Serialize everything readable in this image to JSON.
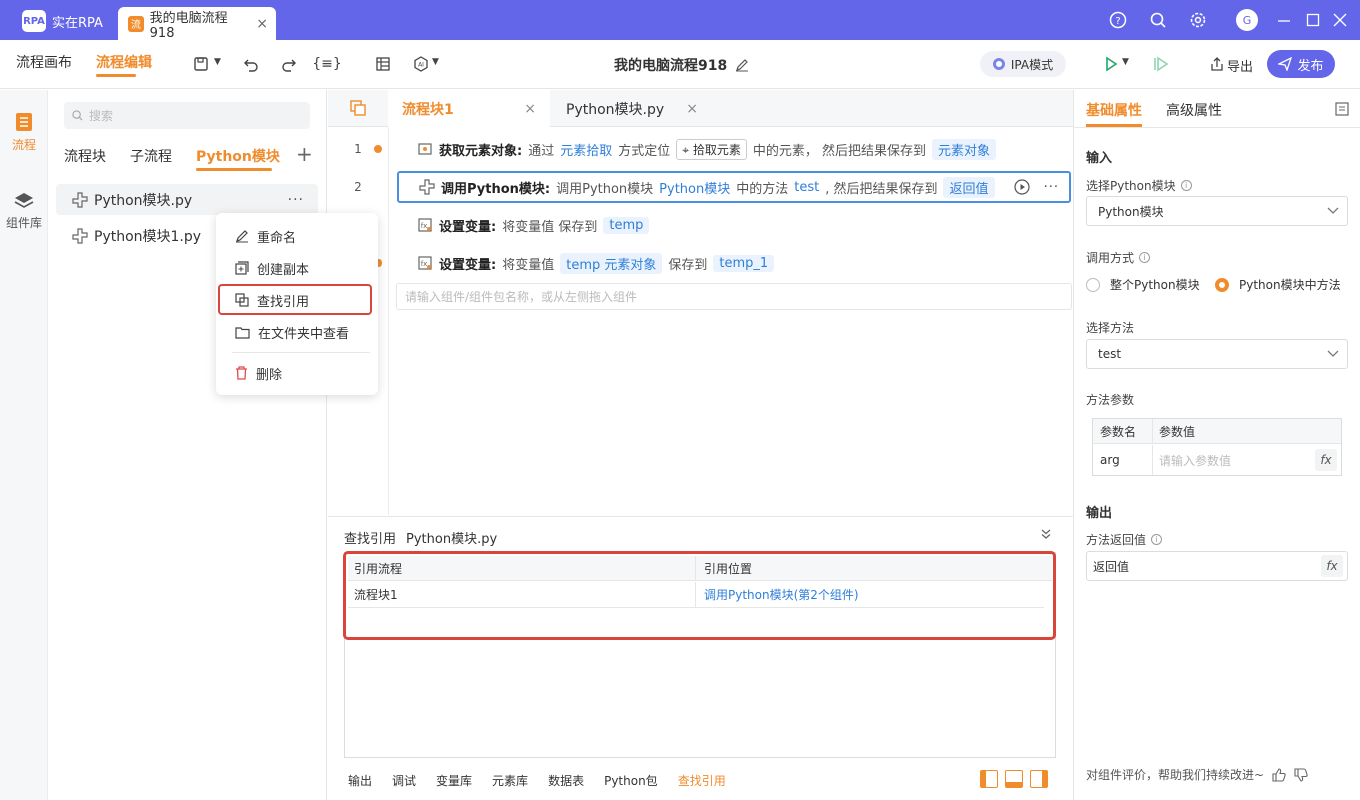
{
  "titlebar": {
    "app_name": "实在RPA",
    "logo_text": "RPA",
    "doc_tab": "我的电脑流程918",
    "tab_icon": "流",
    "avatar": "G",
    "accent": "#6366e8"
  },
  "toolbar": {
    "mode_canvas": "流程画布",
    "mode_edit": "流程编辑",
    "flow_title": "我的电脑流程918",
    "ipa_mode": "IPA模式",
    "export": "导出",
    "publish": "发布",
    "accent": "#f08c2c"
  },
  "rail": {
    "flow": "流程",
    "components": "组件库"
  },
  "left": {
    "search_placeholder": "搜索",
    "tabs": [
      "流程块",
      "子流程",
      "Python模块"
    ],
    "files": [
      "Python模块.py",
      "Python模块1.py"
    ],
    "more": "···"
  },
  "ctx_menu": {
    "items": [
      "重命名",
      "创建副本",
      "查找引用",
      "在文件夹中查看",
      "删除"
    ]
  },
  "editor": {
    "tabs": [
      "流程块1",
      "Python模块.py"
    ],
    "line_numbers": [
      "1",
      "2"
    ],
    "rows": [
      {
        "name": "获取元素对象:",
        "t1": "通过",
        "link": "元素拾取",
        "t2": "方式定位",
        "btn": "拾取元素",
        "t3": "中的元素， 然后把结果保存到",
        "tag": "元素对象"
      },
      {
        "name": "调用Python模块:",
        "t1": "调用Python模块",
        "link": "Python模块",
        "t2": "中的方法",
        "link2": "test",
        "t3": ", 然后把结果保存到",
        "tag": "返回值"
      },
      {
        "name": "设置变量:",
        "t1": "将变量值 保存到",
        "tag": "temp"
      },
      {
        "name": "设置变量:",
        "t1": "将变量值",
        "link": "temp 元素对象",
        "t2": "保存到",
        "tag": "temp_1"
      }
    ],
    "add_placeholder": "请输入组件/组件包名称，或从左侧拖入组件"
  },
  "bottom": {
    "title": "查找引用",
    "file": "Python模块.py",
    "headers": [
      "引用流程",
      "引用位置"
    ],
    "row": {
      "flow": "流程块1",
      "location": "调用Python模块(第2个组件)"
    },
    "tabs": [
      "输出",
      "调试",
      "变量库",
      "元素库",
      "数据表",
      "Python包",
      "查找引用"
    ]
  },
  "right": {
    "tabs": [
      "基础属性",
      "高级属性"
    ],
    "input_section": "输入",
    "select_module_label": "选择Python模块",
    "select_module_value": "Python模块",
    "call_mode_label": "调用方式",
    "call_mode_options": [
      "整个Python模块",
      "Python模块中方法"
    ],
    "select_method_label": "选择方法",
    "select_method_value": "test",
    "params_label": "方法参数",
    "params_headers": [
      "参数名",
      "参数值"
    ],
    "param_name": "arg",
    "param_placeholder": "请输入参数值",
    "fx": "fx",
    "output_section": "输出",
    "return_label": "方法返回值",
    "return_value": "返回值",
    "feedback": "对组件评价，帮助我们持续改进~"
  }
}
